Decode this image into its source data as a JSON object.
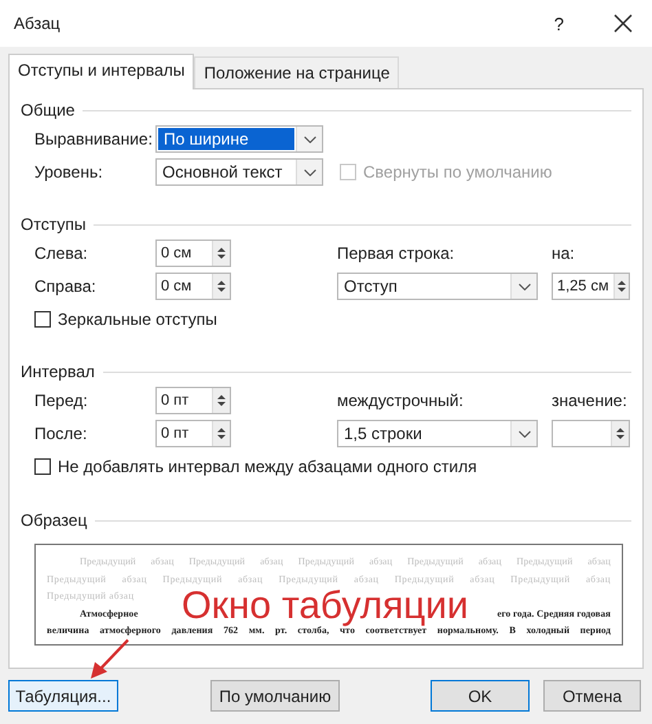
{
  "window": {
    "title": "Абзац",
    "help": "?"
  },
  "tabs": [
    {
      "label": "Отступы и интервалы",
      "selected": true
    },
    {
      "label": "Положение на странице",
      "selected": false
    }
  ],
  "general": {
    "title": "Общие",
    "alignment": {
      "label": "Выравнивание:",
      "value": "По ширине",
      "highlighted": true
    },
    "level": {
      "label": "Уровень:",
      "value": "Основной текст",
      "highlighted": false
    },
    "collapsed": {
      "label": "Свернуты по умолчанию",
      "checked": false,
      "disabled": true
    }
  },
  "indents": {
    "title": "Отступы",
    "left": {
      "label": "Слева:",
      "value": "0 см"
    },
    "right": {
      "label": "Справа:",
      "value": "0 см"
    },
    "first_line": {
      "label": "Первая строка:",
      "value": "Отступ"
    },
    "by": {
      "label": "на:",
      "value": "1,25 см"
    },
    "mirror": {
      "label": "Зеркальные отступы",
      "checked": false,
      "disabled": false
    }
  },
  "spacing": {
    "title": "Интервал",
    "before": {
      "label": "Перед:",
      "value": "0 пт"
    },
    "after": {
      "label": "После:",
      "value": "0 пт"
    },
    "line_spacing": {
      "label": "междустрочный:",
      "value": "1,5 строки"
    },
    "at": {
      "label": "значение:"
    },
    "no_space": {
      "label": "Не добавлять интервал между абзацами одного стиля",
      "checked": false,
      "disabled": false
    }
  },
  "preview": {
    "title": "Образец",
    "previous_lines": [
      "Предыдущий абзац Предыдущий абзац Предыдущий абзац Предыдущий абзац Предыдущий абзац",
      "Предыдущий абзац Предыдущий абзац Предыдущий абзац Предыдущий абзац Предыдущий абзац",
      "Предыдущий абзац"
    ],
    "current_start": "Атмосферное",
    "current_end": "его года. Средняя годовая",
    "current_lines": [
      "величина атмосферного давления 762 мм. рт. столба, что соответствует нормальному. В холодный период"
    ]
  },
  "annotation": {
    "text": "Окно табуляции"
  },
  "buttons": [
    {
      "label": "Табуляция...",
      "highlighted": true
    },
    {
      "label": "По умолчанию",
      "highlighted": false
    },
    {
      "label": "OK",
      "highlighted": true
    },
    {
      "label": "Отмена",
      "highlighted": false
    }
  ]
}
